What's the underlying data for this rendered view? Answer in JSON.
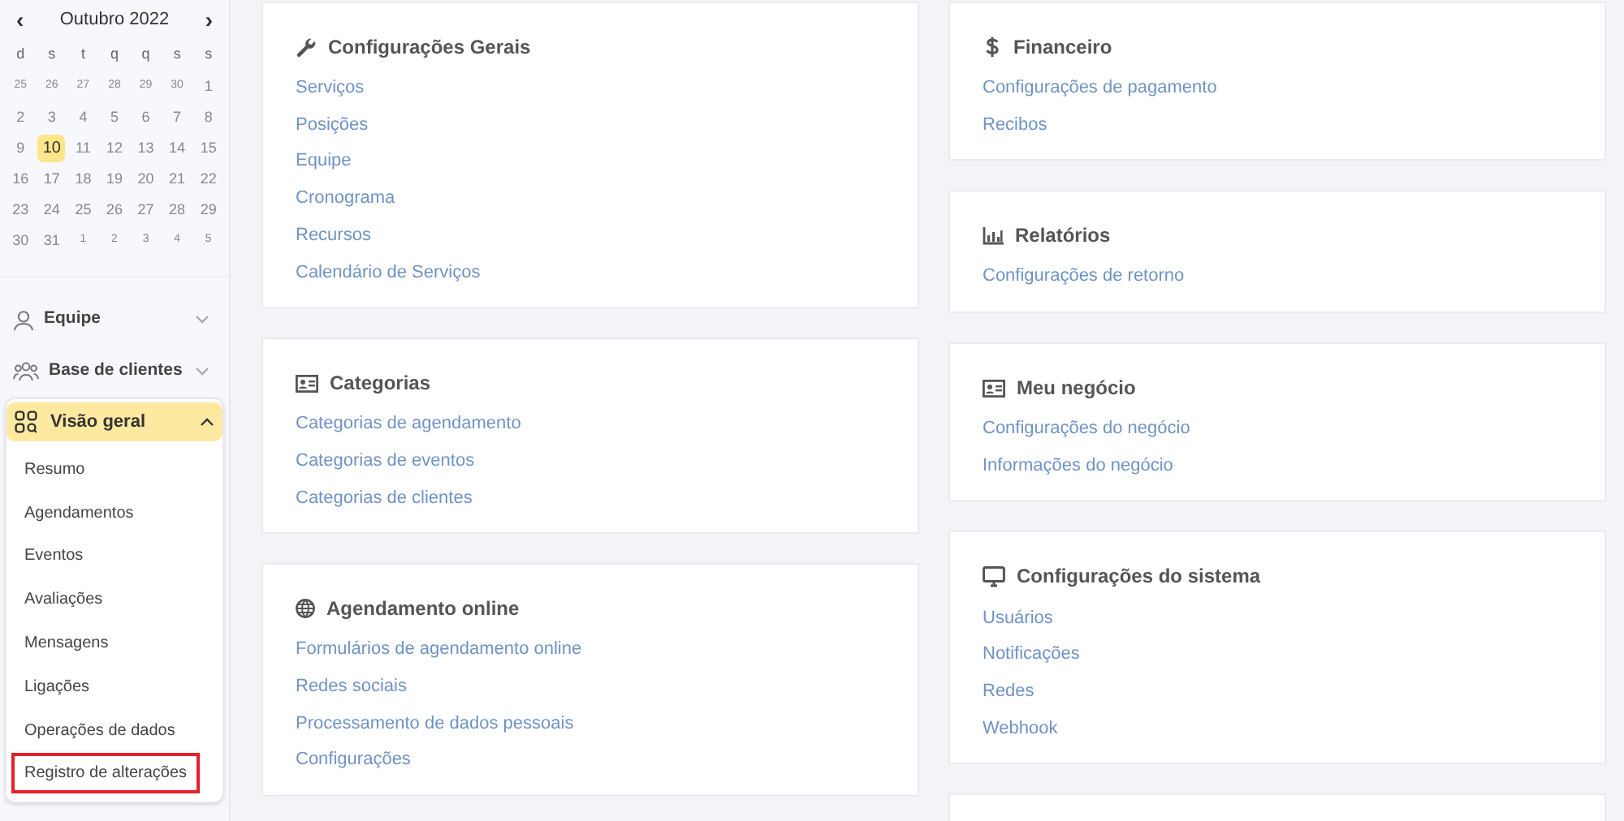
{
  "calendar": {
    "month": "Outubro 2022",
    "prev": "‹",
    "next": "›",
    "weekdays": [
      "d",
      "s",
      "t",
      "q",
      "q",
      "s",
      "s"
    ],
    "days": [
      {
        "label": "25",
        "outside": true,
        "selected": false
      },
      {
        "label": "26",
        "outside": true,
        "selected": false
      },
      {
        "label": "27",
        "outside": true,
        "selected": false
      },
      {
        "label": "28",
        "outside": true,
        "selected": false
      },
      {
        "label": "29",
        "outside": true,
        "selected": false
      },
      {
        "label": "30",
        "outside": true,
        "selected": false
      },
      {
        "label": "1",
        "outside": false,
        "selected": false
      },
      {
        "label": "2",
        "outside": false,
        "selected": false
      },
      {
        "label": "3",
        "outside": false,
        "selected": false
      },
      {
        "label": "4",
        "outside": false,
        "selected": false
      },
      {
        "label": "5",
        "outside": false,
        "selected": false
      },
      {
        "label": "6",
        "outside": false,
        "selected": false
      },
      {
        "label": "7",
        "outside": false,
        "selected": false
      },
      {
        "label": "8",
        "outside": false,
        "selected": false
      },
      {
        "label": "9",
        "outside": false,
        "selected": false
      },
      {
        "label": "10",
        "outside": false,
        "selected": true
      },
      {
        "label": "11",
        "outside": false,
        "selected": false
      },
      {
        "label": "12",
        "outside": false,
        "selected": false
      },
      {
        "label": "13",
        "outside": false,
        "selected": false
      },
      {
        "label": "14",
        "outside": false,
        "selected": false
      },
      {
        "label": "15",
        "outside": false,
        "selected": false
      },
      {
        "label": "16",
        "outside": false,
        "selected": false
      },
      {
        "label": "17",
        "outside": false,
        "selected": false
      },
      {
        "label": "18",
        "outside": false,
        "selected": false
      },
      {
        "label": "19",
        "outside": false,
        "selected": false
      },
      {
        "label": "20",
        "outside": false,
        "selected": false
      },
      {
        "label": "21",
        "outside": false,
        "selected": false
      },
      {
        "label": "22",
        "outside": false,
        "selected": false
      },
      {
        "label": "23",
        "outside": false,
        "selected": false
      },
      {
        "label": "24",
        "outside": false,
        "selected": false
      },
      {
        "label": "25",
        "outside": false,
        "selected": false
      },
      {
        "label": "26",
        "outside": false,
        "selected": false
      },
      {
        "label": "27",
        "outside": false,
        "selected": false
      },
      {
        "label": "28",
        "outside": false,
        "selected": false
      },
      {
        "label": "29",
        "outside": false,
        "selected": false
      },
      {
        "label": "30",
        "outside": false,
        "selected": false
      },
      {
        "label": "31",
        "outside": false,
        "selected": false
      },
      {
        "label": "1",
        "outside": true,
        "selected": false
      },
      {
        "label": "2",
        "outside": true,
        "selected": false
      },
      {
        "label": "3",
        "outside": true,
        "selected": false
      },
      {
        "label": "4",
        "outside": true,
        "selected": false
      },
      {
        "label": "5",
        "outside": true,
        "selected": false
      }
    ]
  },
  "menu": [
    {
      "label": "Equipe",
      "kind": "user",
      "expanded": false
    },
    {
      "label": "Base de clientes",
      "kind": "users",
      "expanded": false
    },
    {
      "label": "Visão geral",
      "kind": "grid",
      "expanded": true,
      "children": [
        {
          "label": "Resumo",
          "highlighted": false
        },
        {
          "label": "Agendamentos",
          "highlighted": false
        },
        {
          "label": "Eventos",
          "highlighted": false
        },
        {
          "label": "Avaliações",
          "highlighted": false
        },
        {
          "label": "Mensagens",
          "highlighted": false
        },
        {
          "label": "Ligações",
          "highlighted": false
        },
        {
          "label": "Operações de dados",
          "highlighted": false
        },
        {
          "label": "Registro de alterações",
          "highlighted": true
        }
      ]
    }
  ],
  "columns": [
    [
      {
        "kind": "wrench",
        "title": "Configurações Gerais",
        "links": [
          "Serviços",
          "Posições",
          "Equipe",
          "Cronograma",
          "Recursos",
          "Calendário de Serviços"
        ]
      },
      {
        "kind": "card",
        "title": "Categorias",
        "links": [
          "Categorias de agendamento",
          "Categorias de eventos",
          "Categorias de clientes"
        ]
      },
      {
        "kind": "globe",
        "title": "Agendamento online",
        "links": [
          "Formulários de agendamento online",
          "Redes sociais",
          "Processamento de dados pessoais",
          "Configurações"
        ]
      }
    ],
    [
      {
        "kind": "dollar",
        "title": "Financeiro",
        "links": [
          "Configurações de pagamento",
          "Recibos"
        ]
      },
      {
        "kind": "chart",
        "title": "Relatórios",
        "links": [
          "Configurações de retorno"
        ]
      },
      {
        "kind": "card",
        "title": "Meu negócio",
        "links": [
          "Configurações do negócio",
          "Informações do negócio"
        ]
      },
      {
        "kind": "monitor",
        "title": "Configurações do sistema",
        "links": [
          "Usuários",
          "Notificações",
          "Redes",
          "Webhook"
        ]
      },
      {
        "kind": "blank"
      }
    ]
  ]
}
